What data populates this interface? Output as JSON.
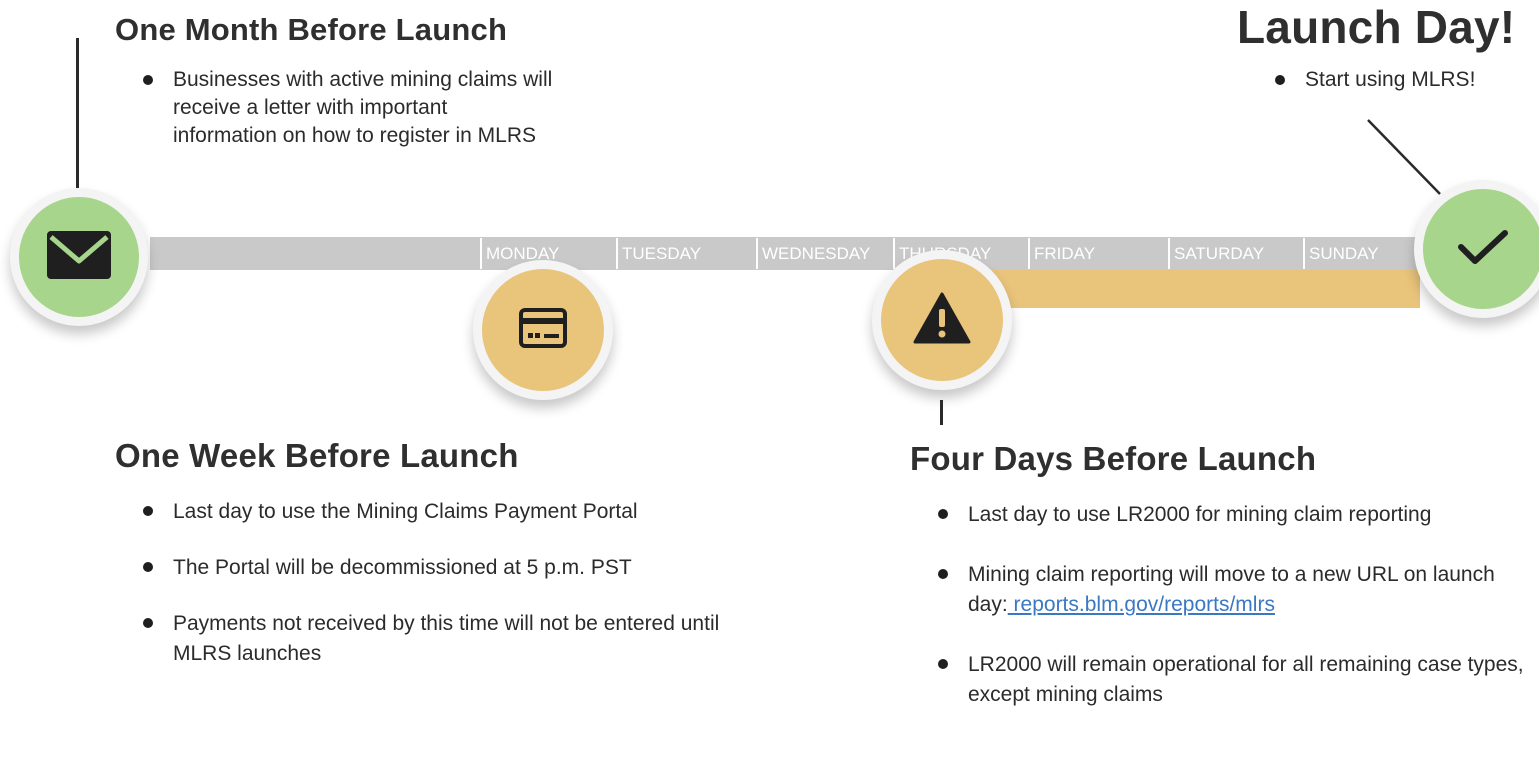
{
  "month_before": {
    "title": "One Month Before Launch",
    "bullets": [
      "Businesses with active mining claims will receive a letter with important information on how to register in MLRS"
    ],
    "icon": "envelope-icon"
  },
  "launch_day": {
    "title": "Launch Day!",
    "bullets": [
      "Start using MLRS!"
    ],
    "icon": "checkmark-icon"
  },
  "week_before": {
    "title": "One Week Before Launch",
    "bullets": [
      "Last day to use the Mining Claims Payment Portal",
      "The Portal will be decommissioned at 5 p.m. PST",
      "Payments not received by this time will not be entered until MLRS launches"
    ],
    "icon": "credit-card-icon"
  },
  "four_days_before": {
    "title": "Four Days Before Launch",
    "bullets": [
      "Last day to use LR2000 for mining claim reporting",
      "Mining claim reporting will move to a new URL on launch day:",
      "LR2000 will remain operational for all remaining case types, except mining claims"
    ],
    "link": " reports.blm.gov/reports/mlrs",
    "icon": "warning-icon"
  },
  "days": [
    "MONDAY",
    "TUESDAY",
    "WEDNESDAY",
    "THURSDAY",
    "FRIDAY",
    "SATURDAY",
    "SUNDAY"
  ],
  "colors": {
    "bar_gray": "#c9c9c9",
    "gold": "#e9c47b",
    "green": "#a7d58b",
    "link_blue": "#3a78c4"
  }
}
